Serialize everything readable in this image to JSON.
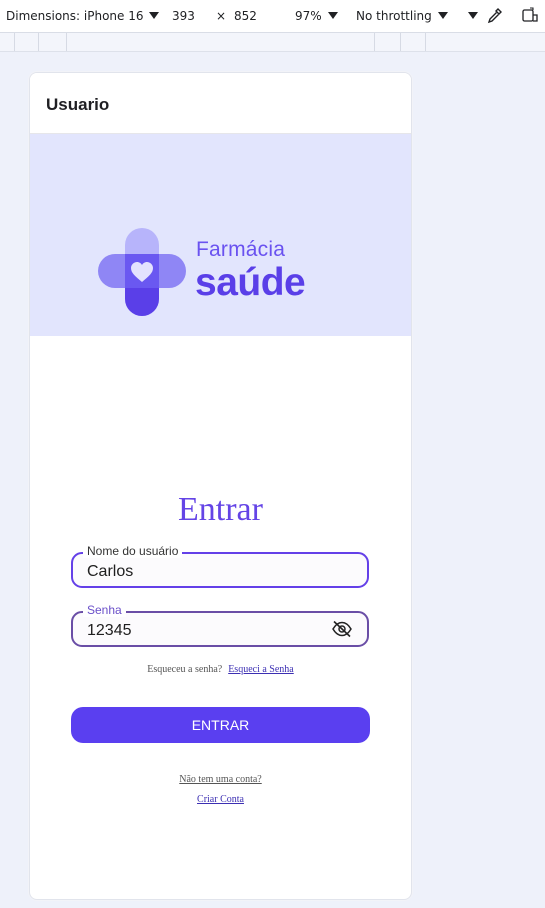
{
  "devtools": {
    "dimensions_label": "Dimensions: iPhone 16",
    "width": "393",
    "times": "×",
    "height": "852",
    "zoom": "97%",
    "throttling": "No throttling"
  },
  "app": {
    "title": "Usuario",
    "brand_line1": "Farmácia",
    "brand_line2": "saúde",
    "heading": "Entrar",
    "username": {
      "label": "Nome do usuário",
      "value": "Carlos"
    },
    "password": {
      "label": "Senha",
      "value": "12345"
    },
    "forgot_prompt": "Esqueceu a senha?",
    "forgot_link": "Esqueci a Senha",
    "submit_label": "ENTRAR",
    "no_account": "Não tem uma conta?",
    "create_account": "Criar Conta"
  },
  "colors": {
    "accent": "#5a3ff0",
    "banner_bg": "#e2e5fd",
    "heading": "#6444e6"
  },
  "icons": {
    "logo": "cross-heart-icon",
    "password_toggle": "eye-off-icon"
  }
}
